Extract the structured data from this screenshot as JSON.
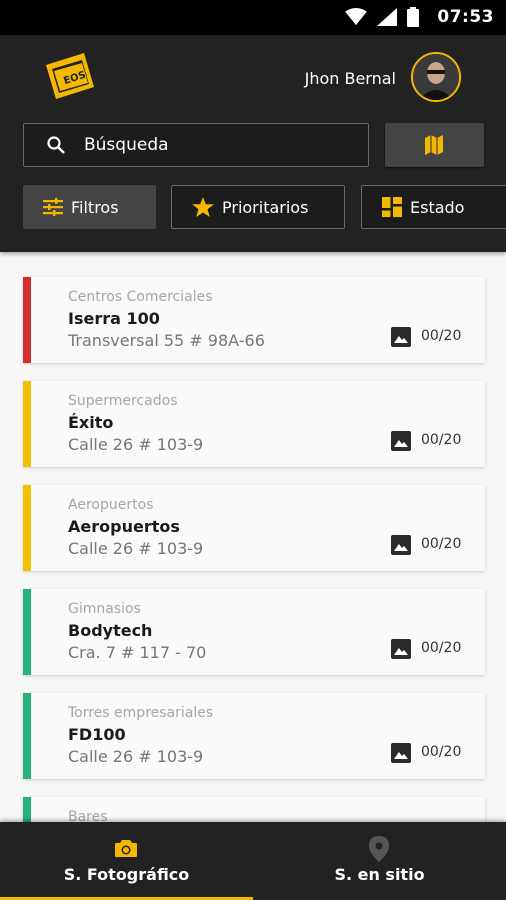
{
  "status_bar": {
    "time": "07:53"
  },
  "header": {
    "logo_text": "EOS",
    "user_name": "Jhon Bernal",
    "search": {
      "placeholder": "Búsqueda"
    },
    "filters": [
      {
        "label": "Filtros",
        "icon": "tune-icon"
      },
      {
        "label": "Prioritarios",
        "icon": "star-icon"
      },
      {
        "label": "Estado",
        "icon": "dashboard-icon"
      }
    ]
  },
  "colors": {
    "accent": "#f5b800",
    "red": "#d32f2f",
    "yellow": "#f5c000",
    "green": "#26b07a",
    "header_bg": "#222222"
  },
  "list": {
    "items": [
      {
        "category": "Centros Comerciales",
        "name": "Iserra 100",
        "address": "Transversal 55 # 98A-66",
        "count": "00/20",
        "status_color": "#d32f2f"
      },
      {
        "category": "Supermercados",
        "name": "Éxito",
        "address": "Calle 26 # 103-9",
        "count": "00/20",
        "status_color": "#f5c000"
      },
      {
        "category": "Aeropuertos",
        "name": "Aeropuertos",
        "address": "Calle 26 # 103-9",
        "count": "00/20",
        "status_color": "#f5c000"
      },
      {
        "category": "Gimnasios",
        "name": "Bodytech",
        "address": "Cra. 7 # 117 - 70",
        "count": "00/20",
        "status_color": "#26b07a"
      },
      {
        "category": "Torres empresariales",
        "name": "FD100",
        "address": "Calle 26 # 103-9",
        "count": "00/20",
        "status_color": "#26b07a"
      },
      {
        "category": "Bares",
        "name": "",
        "address": "",
        "count": "",
        "status_color": "#26b07a"
      }
    ]
  },
  "bottom_nav": {
    "tabs": [
      {
        "label": "S. Fotográfico",
        "icon": "camera-icon",
        "active": true
      },
      {
        "label": "S. en sitio",
        "icon": "location-pin-icon",
        "active": false
      }
    ]
  }
}
